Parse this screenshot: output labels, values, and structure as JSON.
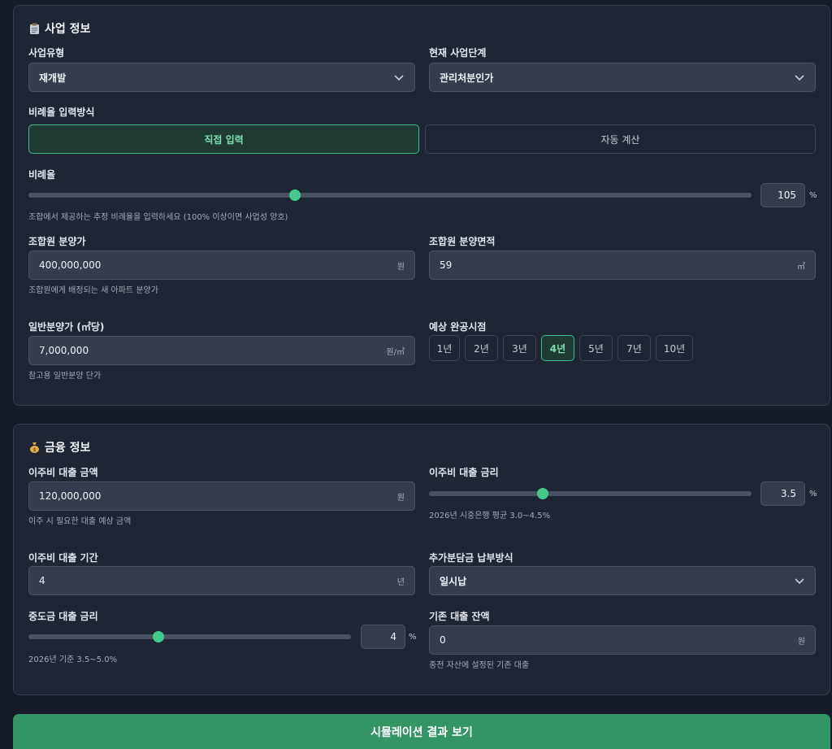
{
  "business": {
    "title": "사업 정보",
    "type_label": "사업유형",
    "type_value": "재개발",
    "stage_label": "현재 사업단계",
    "stage_value": "관리처분인가",
    "ratio_mode_label": "비례율 입력방식",
    "ratio_mode_options": [
      "직접 입력",
      "자동 계산"
    ],
    "ratio_mode_selected": "직접 입력",
    "ratio_label": "비례율",
    "ratio_value": "105",
    "ratio_unit": "%",
    "ratio_slider_fraction": 0.35,
    "ratio_help": "조합에서 제공하는 추정 비례율을 입력하세요 (100% 이상이면 사업성 양호)",
    "member_price_label": "조합원 분양가",
    "member_price_value": "400,000,000",
    "member_price_unit": "원",
    "member_price_help": "조합원에게 배정되는 새 아파트 분양가",
    "member_area_label": "조합원 분양면적",
    "member_area_value": "59",
    "member_area_unit": "㎡",
    "general_price_label": "일반분양가 (㎡당)",
    "general_price_value": "7,000,000",
    "general_price_unit": "원/㎡",
    "general_price_help": "참고용 일반분양 단가",
    "completion_label": "예상 완공시점",
    "completion_options": [
      "1년",
      "2년",
      "3년",
      "4년",
      "5년",
      "7년",
      "10년"
    ],
    "completion_selected": "4년"
  },
  "finance": {
    "title": "금융 정보",
    "moving_loan_label": "이주비 대출 금액",
    "moving_loan_value": "120,000,000",
    "moving_loan_unit": "원",
    "moving_loan_help": "이주 시 필요한 대출 예상 금액",
    "moving_rate_label": "이주비 대출 금리",
    "moving_rate_value": "3.5",
    "moving_rate_unit": "%",
    "moving_rate_slider_fraction": 0.36,
    "moving_rate_help": "2026년 시중은행 평균 3.0~4.5%",
    "moving_period_label": "이주비 대출 기간",
    "moving_period_value": "4",
    "moving_period_unit": "년",
    "payment_method_label": "추가분담금 납부방식",
    "payment_method_value": "일시납",
    "middle_rate_label": "중도금 대출 금리",
    "middle_rate_value": "4",
    "middle_rate_unit": "%",
    "middle_rate_slider_fraction": 0.4,
    "middle_rate_help": "2026년 기준 3.5~5.0%",
    "existing_loan_label": "기존 대출 잔액",
    "existing_loan_value": "0",
    "existing_loan_unit": "원",
    "existing_loan_help": "종전 자산에 설정된 기존 대출"
  },
  "cta_label": "시뮬레이션 결과 보기",
  "colors": {
    "accent": "#43c98c",
    "cta": "#339466",
    "card": "#1f2633",
    "background": "#151b27"
  }
}
